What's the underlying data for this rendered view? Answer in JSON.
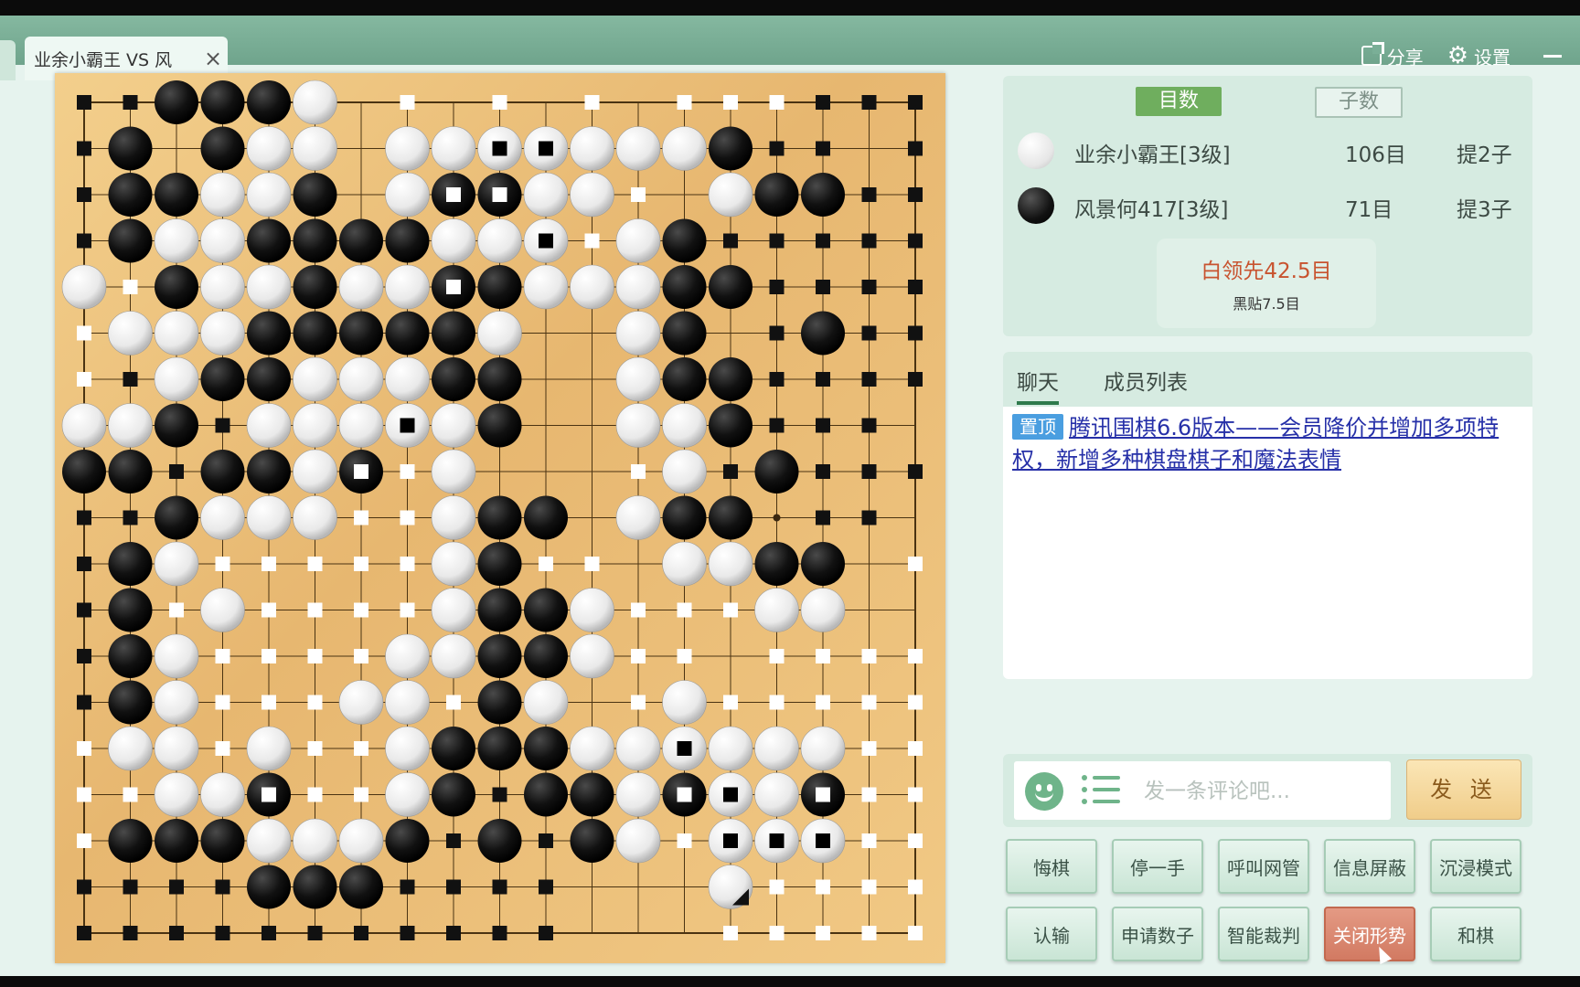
{
  "tab": {
    "title": "业余小霸王 VS 风",
    "close_icon": "×"
  },
  "top_actions": {
    "share": "分享",
    "settings": "设置"
  },
  "score_panel": {
    "mode_active": "目数",
    "mode_inactive": "子数",
    "players": [
      {
        "color": "white",
        "name": "业余小霸王[3级]",
        "score": "106目",
        "captures": "提2子"
      },
      {
        "color": "black",
        "name": "风景何417[3级]",
        "score": "71目",
        "captures": "提3子"
      }
    ],
    "lead_text": "白领先42.5目",
    "komi_text": "黑贴7.5目"
  },
  "chat": {
    "tabs": [
      "聊天",
      "成员列表"
    ],
    "pinned_tag": "置顶",
    "pinned_text": "腾讯围棋6.6版本——会员降价并增加多项特权，新增多种棋盘棋子和魔法表情"
  },
  "input": {
    "placeholder": "发一条评论吧...",
    "send": "发 送"
  },
  "controls": {
    "row1": [
      "悔棋",
      "停一手",
      "呼叫网管",
      "信息屏蔽",
      "沉浸模式"
    ],
    "row2": [
      "认输",
      "申请数子",
      "智能裁判",
      "关闭形势",
      "和棋"
    ]
  },
  "board": {
    "size": 19,
    "legend": "B=black stone, W=white stone, b=black territory marker, w=white territory marker; lowercase after stone (X/Y)=dead stone marked",
    "rows": [
      "bbBBBW.w.w.w.wwwbbb",
      "bB.BWW.WWYYWWWBbb.b",
      "bBBWWB.WXXWWw.WBBbb",
      "bBWWBBBBWWYwWBbbbbb",
      "WwBWWBWWXBWWWBBbbbb",
      "wWWWBBBBBW..WB.bBbb",
      "wbWBBWWWBB..WBBbbbb",
      "WWBbWWWYWB..WWBbbb.",
      "BBbBBWXwW...wWbBbbb",
      "bbBWWWwwWBB.WBB.bb.",
      "bBWwwwwwWBww WWBB.w",
      "bBwWwwwwWBBWwwwWW..",
      "bBWwwwwWWBBWww.wwww",
      "bBWwwwWWwBW.wWwwwww",
      "wWWwWwwWBBBWWYWWWww",
      "wwWWXwwWBbBBWXYWXww",
      "wBBBWWWBbBbBWwYYYww",
      "bbbbBBBbbbb...Zwwww",
      "bbbbbbbbbbb...wwwww"
    ]
  }
}
